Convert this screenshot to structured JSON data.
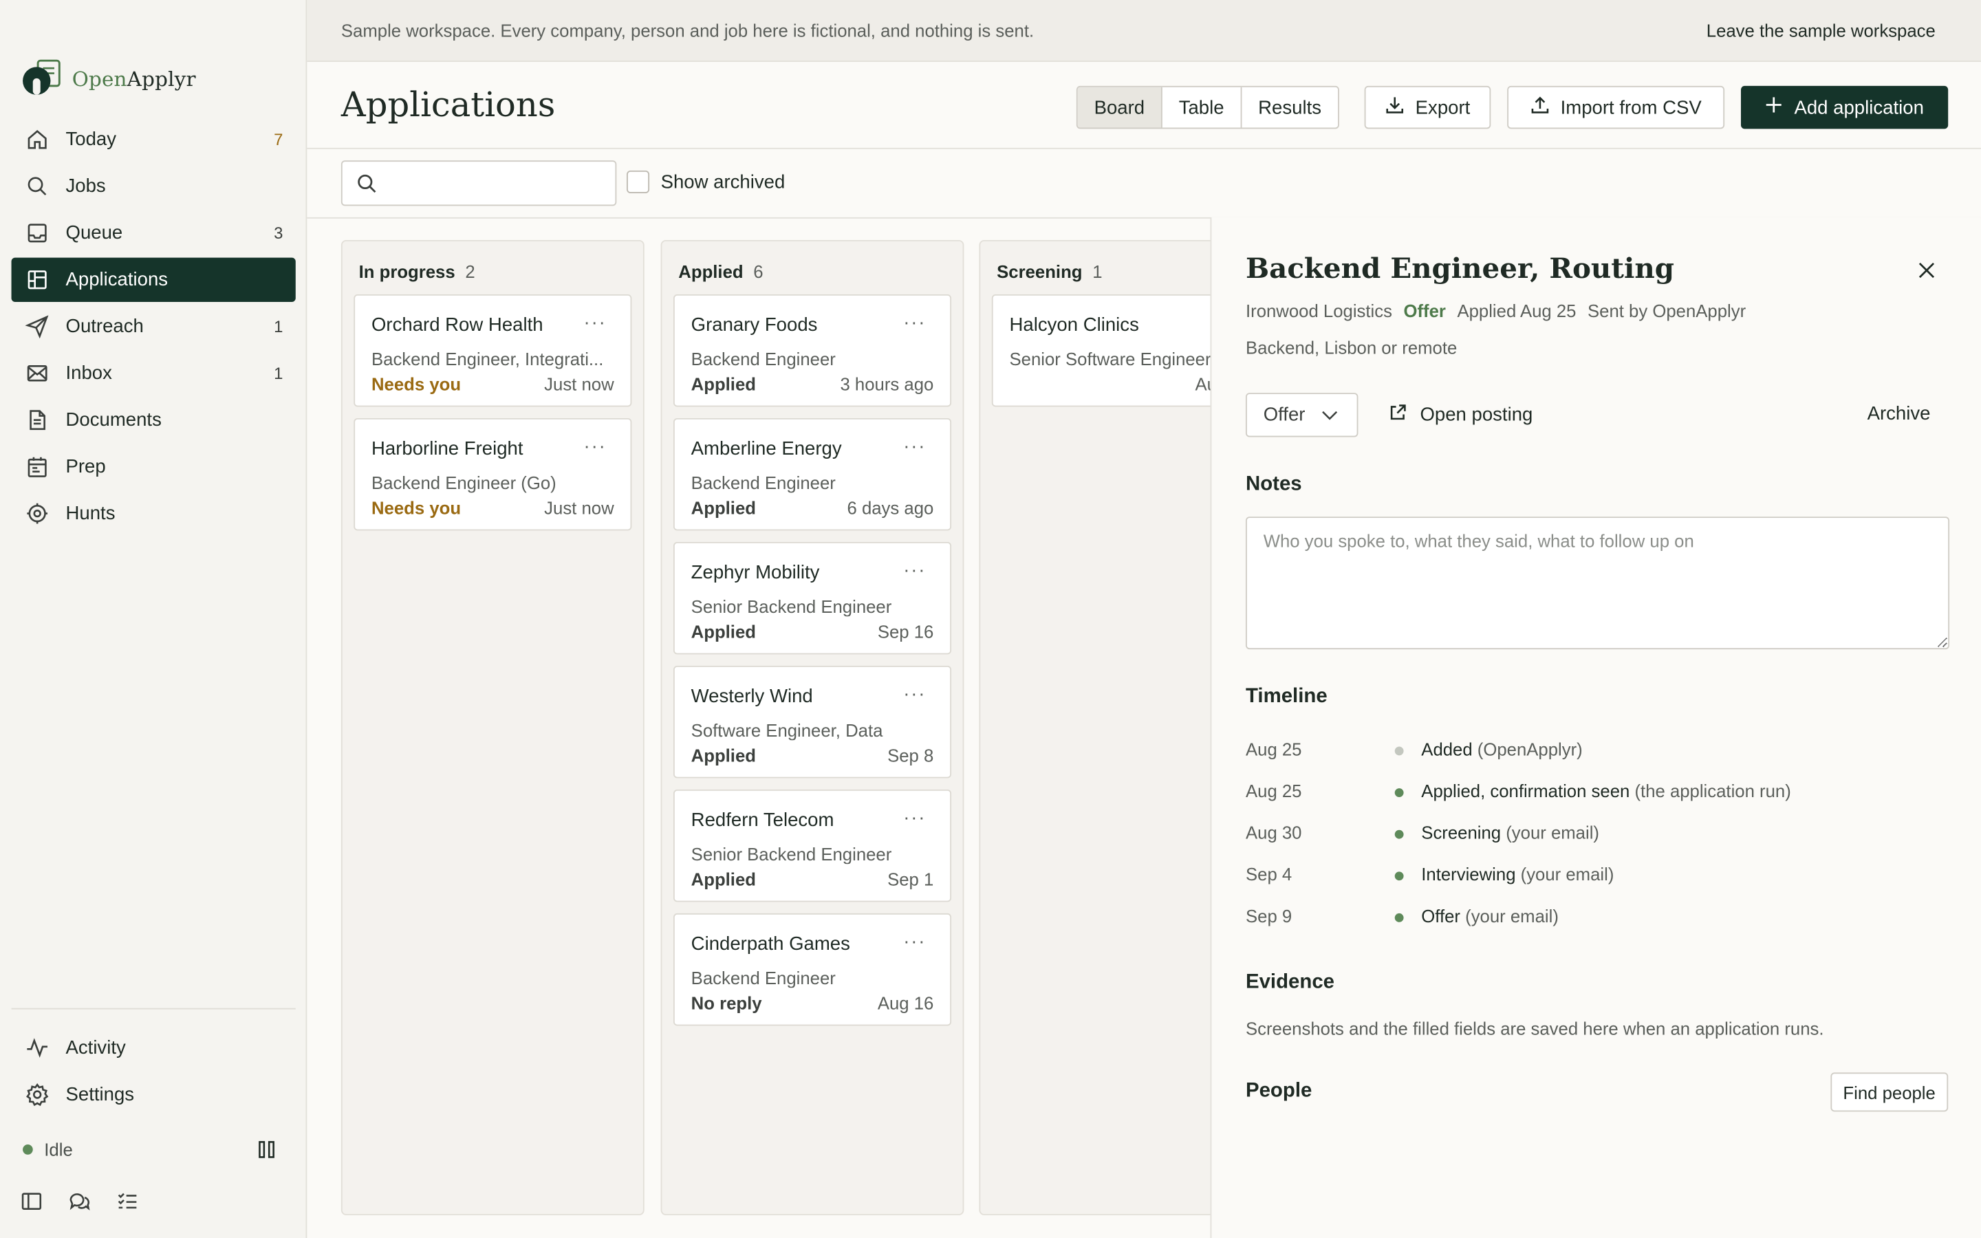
{
  "banner": {
    "text": "Sample workspace. Every company, person and job here is fictional, and nothing is sent.",
    "leave": "Leave the sample workspace"
  },
  "brand": {
    "open": "Open",
    "rest": "Applyr"
  },
  "sidebar": {
    "items": [
      {
        "label": "Today",
        "count": "7",
        "icon": "home-icon"
      },
      {
        "label": "Jobs",
        "count": "",
        "icon": "search-icon"
      },
      {
        "label": "Queue",
        "count": "3",
        "icon": "inbox-tray-icon"
      },
      {
        "label": "Applications",
        "count": "",
        "icon": "board-icon",
        "active": true
      },
      {
        "label": "Outreach",
        "count": "1",
        "icon": "send-icon"
      },
      {
        "label": "Inbox",
        "count": "1",
        "icon": "mail-icon"
      },
      {
        "label": "Documents",
        "count": "",
        "icon": "document-icon"
      },
      {
        "label": "Prep",
        "count": "",
        "icon": "calendar-icon"
      },
      {
        "label": "Hunts",
        "count": "",
        "icon": "target-icon"
      }
    ],
    "bottom": [
      {
        "label": "Activity",
        "icon": "activity-icon"
      },
      {
        "label": "Settings",
        "icon": "gear-icon"
      }
    ],
    "status": "Idle"
  },
  "header": {
    "title": "Applications",
    "views": [
      "Board",
      "Table",
      "Results"
    ],
    "active_view": "Board",
    "export": "Export",
    "import": "Import from CSV",
    "add": "Add application"
  },
  "toolbar": {
    "search_value": "",
    "search_placeholder": "",
    "show_archived": "Show archived"
  },
  "board": {
    "columns": [
      {
        "title": "In progress",
        "count": "2",
        "cards": [
          {
            "company": "Orchard Row Health",
            "role": "Backend Engineer, Integrati...",
            "status": "Needs you",
            "time": "Just now"
          },
          {
            "company": "Harborline Freight",
            "role": "Backend Engineer (Go)",
            "status": "Needs you",
            "time": "Just now"
          }
        ]
      },
      {
        "title": "Applied",
        "count": "6",
        "cards": [
          {
            "company": "Granary Foods",
            "role": "Backend Engineer",
            "status": "Applied",
            "time": "3 hours ago"
          },
          {
            "company": "Amberline Energy",
            "role": "Backend Engineer",
            "status": "Applied",
            "time": "6 days ago"
          },
          {
            "company": "Zephyr Mobility",
            "role": "Senior Backend Engineer",
            "status": "Applied",
            "time": "Sep 16"
          },
          {
            "company": "Westerly Wind",
            "role": "Software Engineer, Data",
            "status": "Applied",
            "time": "Sep 8"
          },
          {
            "company": "Redfern Telecom",
            "role": "Senior Backend Engineer",
            "status": "Applied",
            "time": "Sep 1"
          },
          {
            "company": "Cinderpath Games",
            "role": "Backend Engineer",
            "status": "No reply",
            "time": "Aug 16"
          }
        ]
      },
      {
        "title": "Screening",
        "count": "1",
        "cards": [
          {
            "company": "Halcyon Clinics",
            "role": "Senior Software Engineer",
            "status": "",
            "time": "Au"
          }
        ]
      }
    ]
  },
  "detail": {
    "title": "Backend Engineer, Routing",
    "company": "Ironwood Logistics",
    "stage": "Offer",
    "applied": "Applied Aug 25",
    "sent_by": "Sent by OpenApplyr",
    "meta2": "Backend, Lisbon or remote",
    "stage_select": "Offer",
    "open_posting": "Open posting",
    "archive": "Archive",
    "notes_heading": "Notes",
    "notes_placeholder": "Who you spoke to, what they said, what to follow up on",
    "timeline_heading": "Timeline",
    "timeline": [
      {
        "date": "Aug 25",
        "event": "Added",
        "source": "(OpenApplyr)"
      },
      {
        "date": "Aug 25",
        "event": "Applied, confirmation seen",
        "source": "(the application run)"
      },
      {
        "date": "Aug 30",
        "event": "Screening",
        "source": "(your email)"
      },
      {
        "date": "Sep 4",
        "event": "Interviewing",
        "source": "(your email)"
      },
      {
        "date": "Sep 9",
        "event": "Offer",
        "source": "(your email)"
      }
    ],
    "evidence_heading": "Evidence",
    "evidence_text": "Screenshots and the filled fields are saved here when an application runs.",
    "people_heading": "People",
    "find_people": "Find people"
  },
  "colors": {
    "accent_dark": "#15342a",
    "brand_green": "#4d7a4a",
    "warning": "#9a6a12",
    "timeline_dot": "#5e8a5a"
  }
}
